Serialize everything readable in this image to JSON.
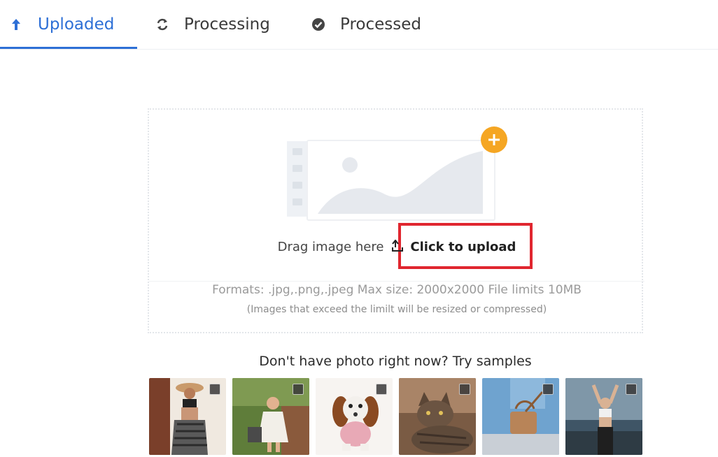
{
  "tabs": [
    {
      "label": "Uploaded",
      "icon": "arrow-up-icon",
      "active": true
    },
    {
      "label": "Processing",
      "icon": "sync-icon",
      "active": false
    },
    {
      "label": "Processed",
      "icon": "check-circle-icon",
      "active": false
    }
  ],
  "upload": {
    "drag_text": "Drag image here",
    "click_text": "Click to upload",
    "formats_text": "Formats: .jpg,.png,.jpeg Max size: 2000x2000 File limits 10MB",
    "note_text": "(Images that exceed the limilt will be resized or compressed)",
    "plus_icon": "plus-icon",
    "upload_icon": "upload-icon"
  },
  "samples": {
    "title": "Don't have photo right now? Try samples",
    "items": [
      {
        "name": "woman-hat"
      },
      {
        "name": "girl-dress"
      },
      {
        "name": "puppy"
      },
      {
        "name": "cat"
      },
      {
        "name": "handbag"
      },
      {
        "name": "woman-sports"
      }
    ]
  },
  "colors": {
    "accent": "#2d6fd6",
    "plus_badge": "#f5a623",
    "highlight": "#e0262f"
  }
}
